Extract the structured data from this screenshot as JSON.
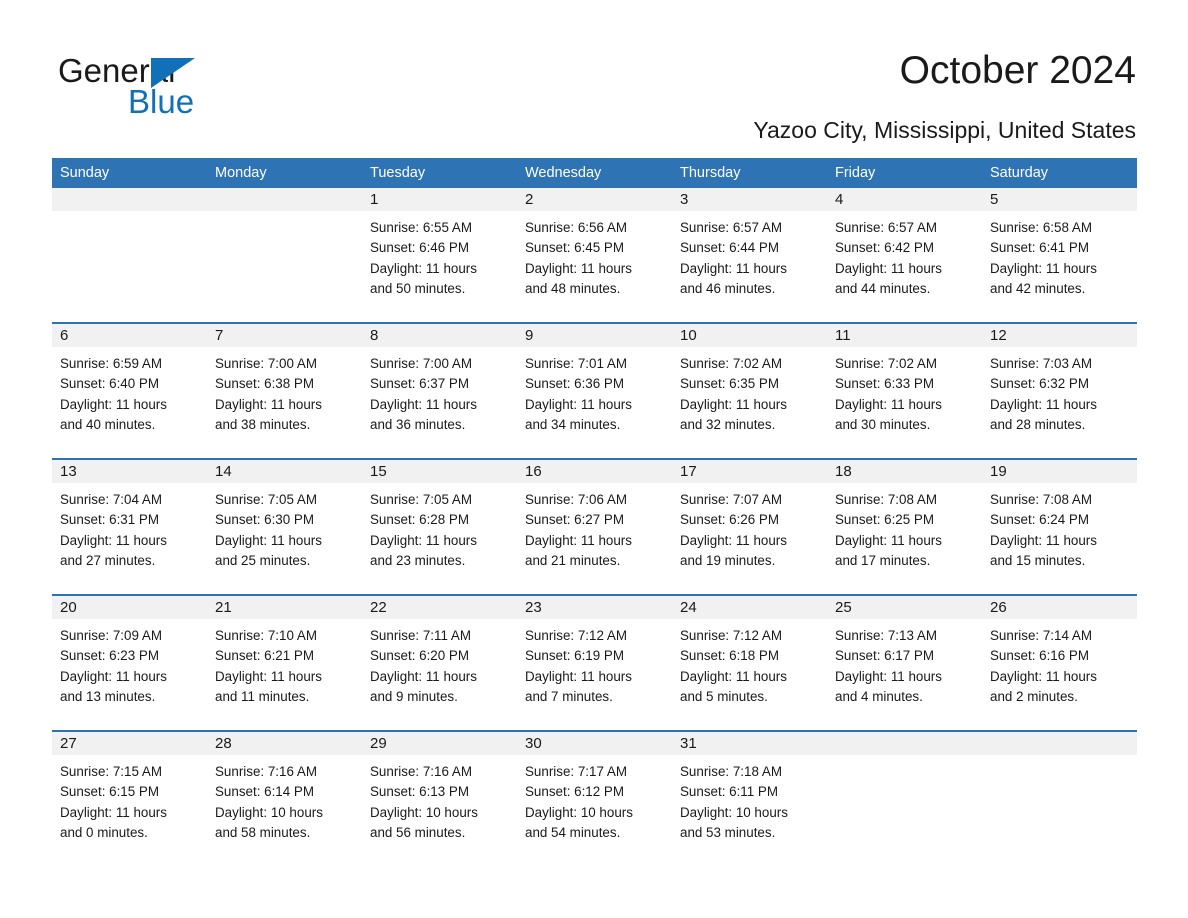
{
  "brand": {
    "name_part1": "General",
    "name_part2": "Blue",
    "triangle_color": "#1071b8"
  },
  "header": {
    "title": "October 2024",
    "subtitle": "Yazoo City, Mississippi, United States"
  },
  "theme": {
    "header_blue": "#2e74b5",
    "date_band_gray": "#f1f1f1",
    "text_color": "#1a1a1a"
  },
  "weekdays": [
    "Sunday",
    "Monday",
    "Tuesday",
    "Wednesday",
    "Thursday",
    "Friday",
    "Saturday"
  ],
  "weeks": [
    [
      {
        "day": "",
        "lines": [
          "",
          "",
          "",
          ""
        ]
      },
      {
        "day": "",
        "lines": [
          "",
          "",
          "",
          ""
        ]
      },
      {
        "day": "1",
        "lines": [
          "Sunrise: 6:55 AM",
          "Sunset: 6:46 PM",
          "Daylight: 11 hours",
          "and 50 minutes."
        ]
      },
      {
        "day": "2",
        "lines": [
          "Sunrise: 6:56 AM",
          "Sunset: 6:45 PM",
          "Daylight: 11 hours",
          "and 48 minutes."
        ]
      },
      {
        "day": "3",
        "lines": [
          "Sunrise: 6:57 AM",
          "Sunset: 6:44 PM",
          "Daylight: 11 hours",
          "and 46 minutes."
        ]
      },
      {
        "day": "4",
        "lines": [
          "Sunrise: 6:57 AM",
          "Sunset: 6:42 PM",
          "Daylight: 11 hours",
          "and 44 minutes."
        ]
      },
      {
        "day": "5",
        "lines": [
          "Sunrise: 6:58 AM",
          "Sunset: 6:41 PM",
          "Daylight: 11 hours",
          "and 42 minutes."
        ]
      }
    ],
    [
      {
        "day": "6",
        "lines": [
          "Sunrise: 6:59 AM",
          "Sunset: 6:40 PM",
          "Daylight: 11 hours",
          "and 40 minutes."
        ]
      },
      {
        "day": "7",
        "lines": [
          "Sunrise: 7:00 AM",
          "Sunset: 6:38 PM",
          "Daylight: 11 hours",
          "and 38 minutes."
        ]
      },
      {
        "day": "8",
        "lines": [
          "Sunrise: 7:00 AM",
          "Sunset: 6:37 PM",
          "Daylight: 11 hours",
          "and 36 minutes."
        ]
      },
      {
        "day": "9",
        "lines": [
          "Sunrise: 7:01 AM",
          "Sunset: 6:36 PM",
          "Daylight: 11 hours",
          "and 34 minutes."
        ]
      },
      {
        "day": "10",
        "lines": [
          "Sunrise: 7:02 AM",
          "Sunset: 6:35 PM",
          "Daylight: 11 hours",
          "and 32 minutes."
        ]
      },
      {
        "day": "11",
        "lines": [
          "Sunrise: 7:02 AM",
          "Sunset: 6:33 PM",
          "Daylight: 11 hours",
          "and 30 minutes."
        ]
      },
      {
        "day": "12",
        "lines": [
          "Sunrise: 7:03 AM",
          "Sunset: 6:32 PM",
          "Daylight: 11 hours",
          "and 28 minutes."
        ]
      }
    ],
    [
      {
        "day": "13",
        "lines": [
          "Sunrise: 7:04 AM",
          "Sunset: 6:31 PM",
          "Daylight: 11 hours",
          "and 27 minutes."
        ]
      },
      {
        "day": "14",
        "lines": [
          "Sunrise: 7:05 AM",
          "Sunset: 6:30 PM",
          "Daylight: 11 hours",
          "and 25 minutes."
        ]
      },
      {
        "day": "15",
        "lines": [
          "Sunrise: 7:05 AM",
          "Sunset: 6:28 PM",
          "Daylight: 11 hours",
          "and 23 minutes."
        ]
      },
      {
        "day": "16",
        "lines": [
          "Sunrise: 7:06 AM",
          "Sunset: 6:27 PM",
          "Daylight: 11 hours",
          "and 21 minutes."
        ]
      },
      {
        "day": "17",
        "lines": [
          "Sunrise: 7:07 AM",
          "Sunset: 6:26 PM",
          "Daylight: 11 hours",
          "and 19 minutes."
        ]
      },
      {
        "day": "18",
        "lines": [
          "Sunrise: 7:08 AM",
          "Sunset: 6:25 PM",
          "Daylight: 11 hours",
          "and 17 minutes."
        ]
      },
      {
        "day": "19",
        "lines": [
          "Sunrise: 7:08 AM",
          "Sunset: 6:24 PM",
          "Daylight: 11 hours",
          "and 15 minutes."
        ]
      }
    ],
    [
      {
        "day": "20",
        "lines": [
          "Sunrise: 7:09 AM",
          "Sunset: 6:23 PM",
          "Daylight: 11 hours",
          "and 13 minutes."
        ]
      },
      {
        "day": "21",
        "lines": [
          "Sunrise: 7:10 AM",
          "Sunset: 6:21 PM",
          "Daylight: 11 hours",
          "and 11 minutes."
        ]
      },
      {
        "day": "22",
        "lines": [
          "Sunrise: 7:11 AM",
          "Sunset: 6:20 PM",
          "Daylight: 11 hours",
          "and 9 minutes."
        ]
      },
      {
        "day": "23",
        "lines": [
          "Sunrise: 7:12 AM",
          "Sunset: 6:19 PM",
          "Daylight: 11 hours",
          "and 7 minutes."
        ]
      },
      {
        "day": "24",
        "lines": [
          "Sunrise: 7:12 AM",
          "Sunset: 6:18 PM",
          "Daylight: 11 hours",
          "and 5 minutes."
        ]
      },
      {
        "day": "25",
        "lines": [
          "Sunrise: 7:13 AM",
          "Sunset: 6:17 PM",
          "Daylight: 11 hours",
          "and 4 minutes."
        ]
      },
      {
        "day": "26",
        "lines": [
          "Sunrise: 7:14 AM",
          "Sunset: 6:16 PM",
          "Daylight: 11 hours",
          "and 2 minutes."
        ]
      }
    ],
    [
      {
        "day": "27",
        "lines": [
          "Sunrise: 7:15 AM",
          "Sunset: 6:15 PM",
          "Daylight: 11 hours",
          "and 0 minutes."
        ]
      },
      {
        "day": "28",
        "lines": [
          "Sunrise: 7:16 AM",
          "Sunset: 6:14 PM",
          "Daylight: 10 hours",
          "and 58 minutes."
        ]
      },
      {
        "day": "29",
        "lines": [
          "Sunrise: 7:16 AM",
          "Sunset: 6:13 PM",
          "Daylight: 10 hours",
          "and 56 minutes."
        ]
      },
      {
        "day": "30",
        "lines": [
          "Sunrise: 7:17 AM",
          "Sunset: 6:12 PM",
          "Daylight: 10 hours",
          "and 54 minutes."
        ]
      },
      {
        "day": "31",
        "lines": [
          "Sunrise: 7:18 AM",
          "Sunset: 6:11 PM",
          "Daylight: 10 hours",
          "and 53 minutes."
        ]
      },
      {
        "day": "",
        "lines": [
          "",
          "",
          "",
          ""
        ]
      },
      {
        "day": "",
        "lines": [
          "",
          "",
          "",
          ""
        ]
      }
    ]
  ]
}
